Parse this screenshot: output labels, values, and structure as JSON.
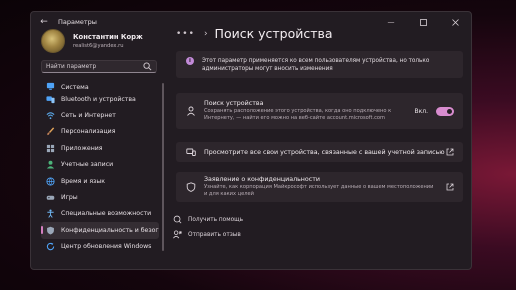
{
  "window": {
    "title": "Параметры",
    "back_icon": "arrow-left-icon",
    "controls": [
      "minimize-icon",
      "maximize-icon",
      "close-icon"
    ]
  },
  "profile": {
    "name": "Константин Корж",
    "email": "realist6@yandex.ru"
  },
  "search": {
    "placeholder": "Найти параметр",
    "icon": "search-icon"
  },
  "sidebar": {
    "items": [
      {
        "label": "Система",
        "icon": "display-icon",
        "color": "#4fa3f7"
      },
      {
        "label": "Bluetooth и устройства",
        "icon": "bluetooth-icon",
        "color": "#4fa3f7"
      },
      {
        "label": "Сеть и Интернет",
        "icon": "wifi-icon",
        "color": "#5aa8e8"
      },
      {
        "label": "Персонализация",
        "icon": "brush-icon",
        "color": "#e0a35a"
      },
      {
        "label": "Приложения",
        "icon": "apps-icon",
        "color": "#9aa7b8"
      },
      {
        "label": "Учетные записи",
        "icon": "person-icon",
        "color": "#4cb37a"
      },
      {
        "label": "Время и язык",
        "icon": "globe-clock-icon",
        "color": "#4fa3f7"
      },
      {
        "label": "Игры",
        "icon": "gamepad-icon",
        "color": "#9aa7b8"
      },
      {
        "label": "Специальные возможности",
        "icon": "accessibility-icon",
        "color": "#6fb6f2"
      },
      {
        "label": "Конфиденциальность и безог",
        "icon": "shield-icon",
        "color": "#9aa7b8",
        "active": true
      },
      {
        "label": "Центр обновления Windows",
        "icon": "update-icon",
        "color": "#4fa3f7"
      }
    ]
  },
  "header": {
    "more": "•••",
    "separator": "›",
    "title": "Поиск устройства"
  },
  "info_banner": {
    "icon": "info-icon",
    "text": "Этот параметр применяется ко всем пользователям устройства, но только администраторы могут вносить изменения"
  },
  "find_device": {
    "icon": "person-location-icon",
    "title": "Поиск устройства",
    "description": "Сохранять расположение этого устройства, когда оно подключено к Интернету, — найти его можно на веб-сайте account.microsoft.com",
    "toggle_label": "Вкл.",
    "toggle_on": true,
    "accent": "#d88ccf"
  },
  "view_devices": {
    "icon": "devices-icon",
    "title": "Просмотрите все свои устройства, связанные с вашей учетной записью",
    "ext_icon": "open-external-icon"
  },
  "privacy_statement": {
    "icon": "shield-icon",
    "title": "Заявление о конфиденциальности",
    "description": "Узнайте, как корпорация Майкрософт использует данные о вашем местоположении и для каких целей",
    "ext_icon": "open-external-icon"
  },
  "links": {
    "help": {
      "label": "Получить помощь",
      "icon": "help-icon"
    },
    "feedback": {
      "label": "Отправить отзыв",
      "icon": "feedback-icon"
    }
  }
}
